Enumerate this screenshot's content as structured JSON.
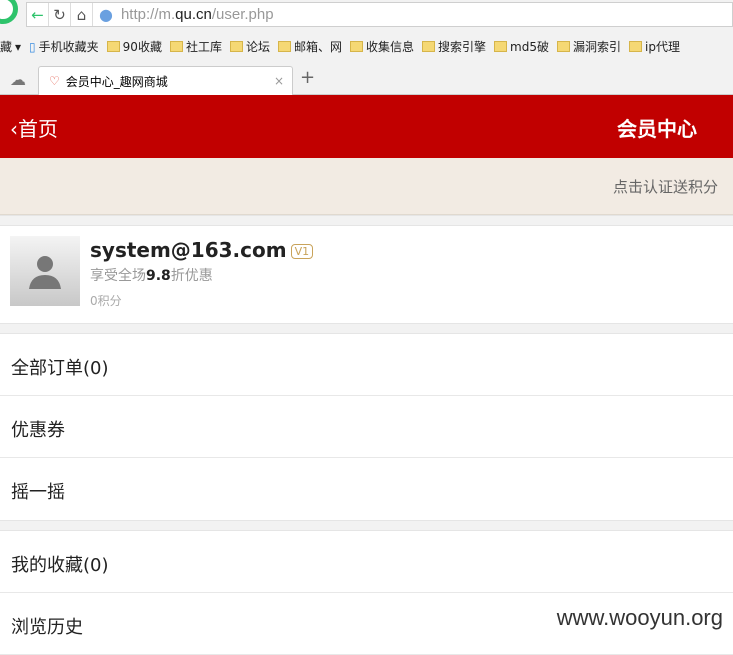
{
  "browser": {
    "url_prefix": "http://m.",
    "url_domain": "qu.cn",
    "url_path": "/user.php",
    "bookmarks": [
      "藏",
      "手机收藏夹",
      "90收藏",
      "社工库",
      "论坛",
      "邮箱、网",
      "收集信息",
      "搜索引擎",
      "md5破",
      "漏洞索引",
      "ip代理"
    ],
    "tab_title": "会员中心_趣网商城"
  },
  "header": {
    "back_label": "首页",
    "title": "会员中心"
  },
  "promo": "点击认证送积分",
  "user": {
    "name": "system@163.com",
    "level": "V1",
    "discount_prefix": "享受全场",
    "discount_value": "9.8",
    "discount_suffix": "折优惠",
    "points": "0积分"
  },
  "menu1": [
    "全部订单(0)",
    "优惠券",
    "摇一摇"
  ],
  "menu2": [
    "我的收藏(0)",
    "浏览历史"
  ],
  "watermark": "www.wooyun.org"
}
